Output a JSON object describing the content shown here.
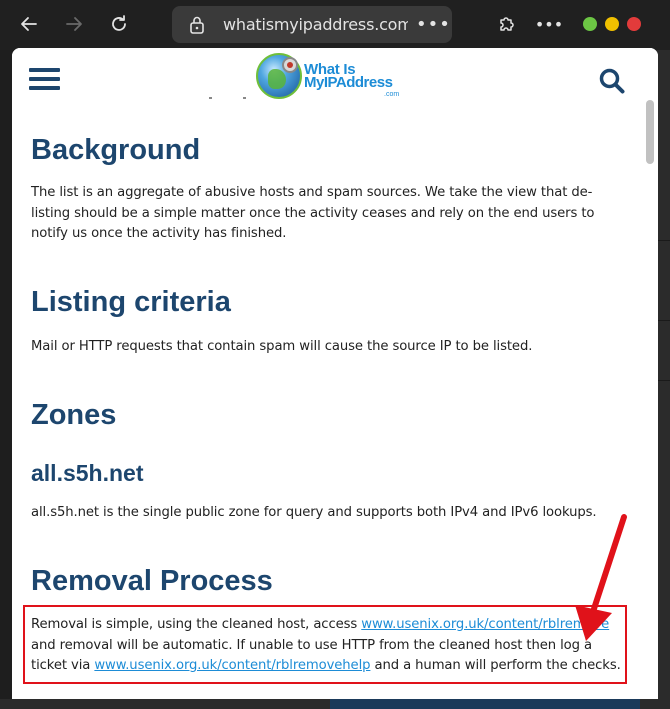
{
  "browser": {
    "url": "whatismyipaddress.com/",
    "more_glyph": "•••",
    "toolbar_more_glyph": "•••",
    "colors": {
      "bg": "#202020",
      "address_bg": "#3a3a3a",
      "text": "#e3e3e3",
      "dot_green": "#6cc644",
      "dot_yellow": "#f0c000",
      "dot_red": "#e23b3b"
    }
  },
  "site": {
    "logo": {
      "line1": "What Is",
      "line2": "MyIPAddress",
      "line3": ".com"
    },
    "colors": {
      "heading": "#1d466e",
      "link": "#1d8cd6",
      "highlight": "#e0121a"
    }
  },
  "sections": {
    "background": {
      "title": "Background",
      "body": "The list is an aggregate of abusive hosts and spam sources. We take the view that de-listing should be a simple matter once the activity ceases and rely on the end users to notify us once the activity has finished."
    },
    "listing": {
      "title": "Listing criteria",
      "body": "Mail or HTTP requests that contain spam will cause the source IP to be listed."
    },
    "zones": {
      "title": "Zones",
      "subtitle": "all.s5h.net",
      "body": "all.s5h.net is the single public zone for query and supports both IPv4 and IPv6 lookups."
    },
    "removal": {
      "title": "Removal Process",
      "text1": "Removal is simple, using the cleaned host, access ",
      "link1": "www.usenix.org.uk/content/rblremove",
      "text2": " and removal will be automatic. If unable to use HTTP from the cleaned host then log a ticket via ",
      "link2": "www.usenix.org.uk/content/rblremovehelp",
      "text3": " and a human will perform the checks."
    }
  }
}
